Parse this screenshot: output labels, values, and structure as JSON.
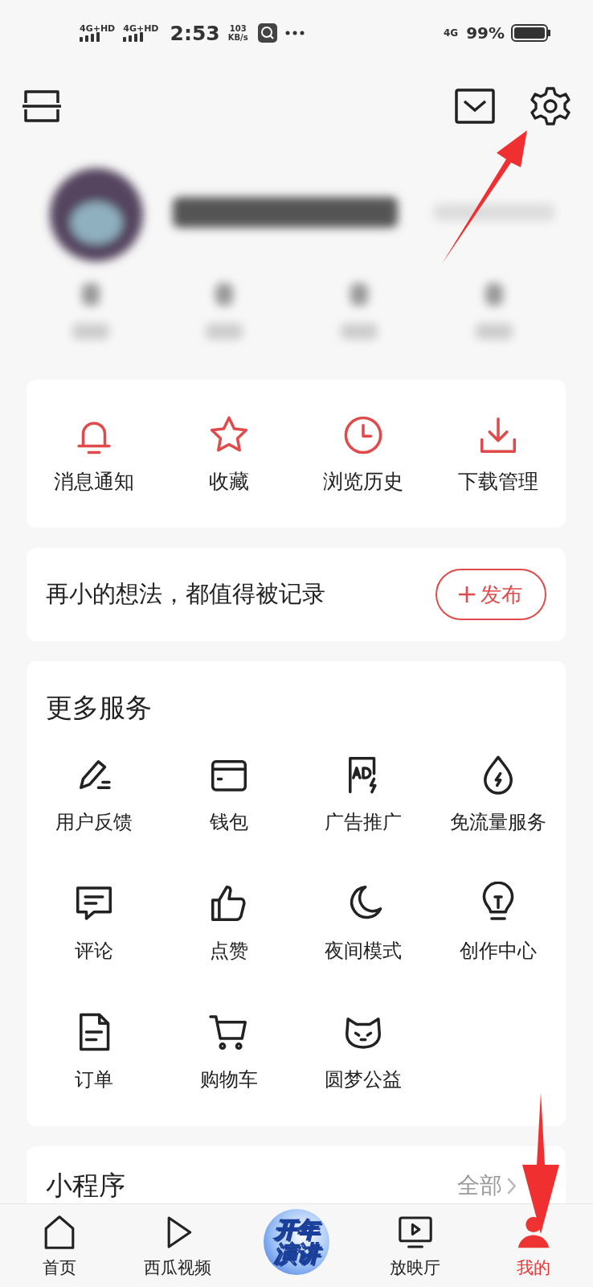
{
  "status_bar": {
    "sim_1": "4G+HD",
    "sim_2": "4G+HD",
    "time": "2:53",
    "speed": "103",
    "speed_unit": "KB/s",
    "network": "4G",
    "battery": "99%"
  },
  "quick_actions": [
    {
      "label": "消息通知",
      "kind": "bell"
    },
    {
      "label": "收藏",
      "kind": "star"
    },
    {
      "label": "浏览历史",
      "kind": "clock"
    },
    {
      "label": "下载管理",
      "kind": "download"
    }
  ],
  "post_prompt": {
    "text": "再小的想法，都值得被记录",
    "button": "发布"
  },
  "more_services": {
    "title": "更多服务",
    "items": [
      {
        "label": "用户反馈",
        "kind": "pen"
      },
      {
        "label": "钱包",
        "kind": "wallet"
      },
      {
        "label": "广告推广",
        "kind": "ad"
      },
      {
        "label": "免流量服务",
        "kind": "drop"
      },
      {
        "label": "评论",
        "kind": "comment"
      },
      {
        "label": "点赞",
        "kind": "thumb"
      },
      {
        "label": "夜间模式",
        "kind": "moon"
      },
      {
        "label": "创作中心",
        "kind": "bulb"
      },
      {
        "label": "订单",
        "kind": "doc"
      },
      {
        "label": "购物车",
        "kind": "cart"
      },
      {
        "label": "圆梦公益",
        "kind": "cat"
      }
    ]
  },
  "mini_programs": {
    "title": "小程序",
    "link": "全部"
  },
  "bottom_nav": [
    {
      "label": "首页",
      "kind": "home",
      "selected": false
    },
    {
      "label": "西瓜视频",
      "kind": "play",
      "selected": false
    },
    {
      "kind": "promo",
      "badge_lines": [
        "开年",
        "演讲"
      ]
    },
    {
      "label": "放映厅",
      "kind": "tv",
      "selected": false
    },
    {
      "label": "我的",
      "kind": "person",
      "selected": true
    }
  ]
}
